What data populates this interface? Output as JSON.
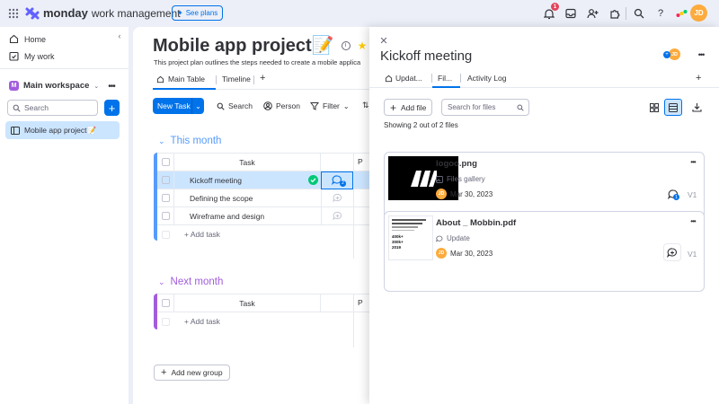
{
  "topbar": {
    "brand": "monday",
    "product": "work management",
    "see_plans": "See plans",
    "notif_count": "1",
    "user_initials": "JD"
  },
  "sidebar": {
    "home": "Home",
    "my_work": "My work",
    "workspace_initial": "M",
    "workspace": "Main workspace",
    "search_placeholder": "Search",
    "board_item": "Mobile app project📝"
  },
  "board": {
    "title": "Mobile app project📝",
    "description": "This project plan outlines the steps needed to create a mobile applica",
    "tabs": [
      "Main Table",
      "Timeline"
    ],
    "new_task": "New Task",
    "toolbar": {
      "search": "Search",
      "person": "Person",
      "filter": "Filter"
    },
    "groups": [
      {
        "name": "This month",
        "color": "#579bfc",
        "column": "Task",
        "col_p": "P",
        "rows": [
          "Kickoff meeting",
          "Defining the scope",
          "Wireframe and design"
        ],
        "add": "+ Add task"
      },
      {
        "name": "Next month",
        "color": "#a25ddc",
        "column": "Task",
        "col_p": "P",
        "rows": [],
        "add": "+ Add task"
      }
    ],
    "add_group": "Add new group"
  },
  "panel": {
    "title": "Kickoff meeting",
    "avatar": "JD",
    "tabs": [
      "Updat...",
      "Fil...",
      "Activity Log"
    ],
    "add_file": "Add file",
    "search_placeholder": "Search for files",
    "showing": "Showing 2 out of 2 files",
    "files": [
      {
        "name": "logoo.png",
        "source": "Files gallery",
        "initials": "JD",
        "date": "Mar 30, 2023",
        "version": "V1",
        "update_count": "1"
      },
      {
        "name": "About _ Mobbin.pdf",
        "source": "Update",
        "initials": "JD",
        "date": "Mar 30, 2023",
        "version": "V1"
      }
    ]
  },
  "colors": {
    "accent": "#0073ea",
    "this_month": "#579bfc",
    "next_month": "#a25ddc",
    "done": "#00c875"
  }
}
